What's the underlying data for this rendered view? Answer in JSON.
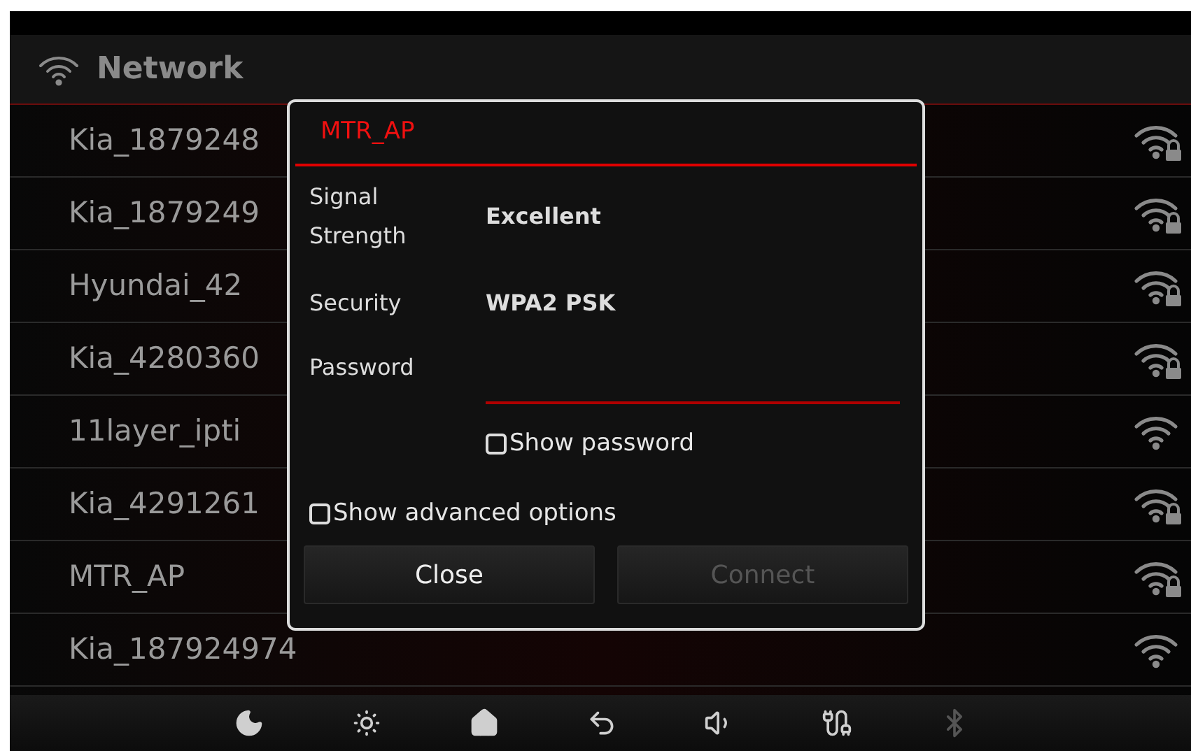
{
  "header": {
    "title": "Network"
  },
  "networks": [
    {
      "name": "Kia_1879248",
      "locked": true
    },
    {
      "name": "Kia_1879249",
      "locked": true
    },
    {
      "name": "Hyundai_42",
      "locked": true
    },
    {
      "name": "Kia_4280360",
      "locked": true
    },
    {
      "name": "11layer_ipti",
      "locked": false
    },
    {
      "name": "Kia_4291261",
      "locked": true
    },
    {
      "name": "MTR_AP",
      "locked": true
    },
    {
      "name": "Kia_187924974",
      "locked": false
    }
  ],
  "dialog": {
    "title": "MTR_AP",
    "fields": [
      {
        "label": "Signal Strength",
        "value": "Excellent"
      },
      {
        "label": "Security",
        "value": "WPA2 PSK"
      }
    ],
    "password": {
      "label": "Password"
    },
    "show_password": {
      "label": "Show password",
      "checked": false
    },
    "show_advanced": {
      "label": "Show advanced options",
      "checked": false
    },
    "buttons": [
      {
        "label": "Close",
        "disabled": false
      },
      {
        "label": "Connect",
        "disabled": true
      }
    ]
  },
  "bottom_bar": [
    {
      "kind": "moon",
      "disabled": false
    },
    {
      "kind": "brightness",
      "disabled": false
    },
    {
      "kind": "home",
      "disabled": false
    },
    {
      "kind": "back",
      "disabled": false
    },
    {
      "kind": "volume",
      "disabled": false
    },
    {
      "kind": "cable",
      "disabled": false
    },
    {
      "kind": "bluetooth",
      "disabled": true
    }
  ]
}
